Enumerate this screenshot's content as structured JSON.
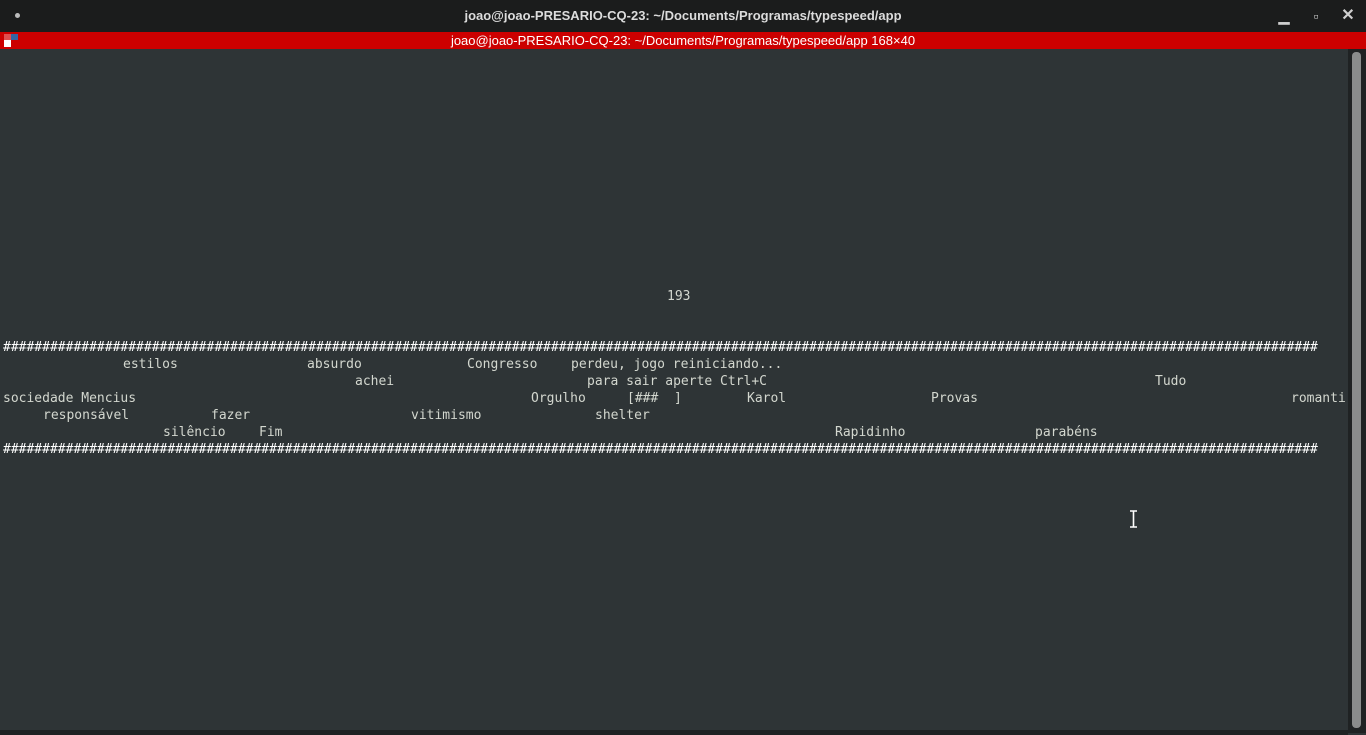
{
  "window": {
    "title": "joao@joao-PRESARIO-CQ-23: ~/Documents/Programas/typespeed/app",
    "controls": {
      "minimize": "▁",
      "maximize": "▫",
      "close": "✕"
    }
  },
  "terminal_header": {
    "title": "joao@joao-PRESARIO-CQ-23: ~/Documents/Programas/typespeed/app 168×40"
  },
  "game": {
    "score": "193",
    "border_top": "########################################################################################################################################################################",
    "border_bottom": "########################################################################################################################################################################",
    "words": {
      "estilos": "estilos",
      "absurdo": "absurdo",
      "congresso": "Congresso",
      "perdeu": "perdeu, jogo reiniciando...",
      "achei": "achei",
      "ctrlc": "para sair aperte Ctrl+C",
      "tudo": "Tudo",
      "sociedade": "sociedade Mencius",
      "orgulho": "Orgulho",
      "progress": "[###  ]",
      "karol": "Karol",
      "provas": "Provas",
      "romanti": "romanti",
      "responsavel": "responsável",
      "fazer": "fazer",
      "vitimismo": "vitimismo",
      "shelter": "shelter",
      "silencio": "silêncio",
      "fim": "Fim",
      "rapidinho": "Rapidinho",
      "parabens": "parabéns"
    }
  },
  "colors": {
    "background": "#2e3436",
    "title_bar": "#1b1c1c",
    "header_bar": "#cc0000",
    "text": "#d3d7cf"
  }
}
